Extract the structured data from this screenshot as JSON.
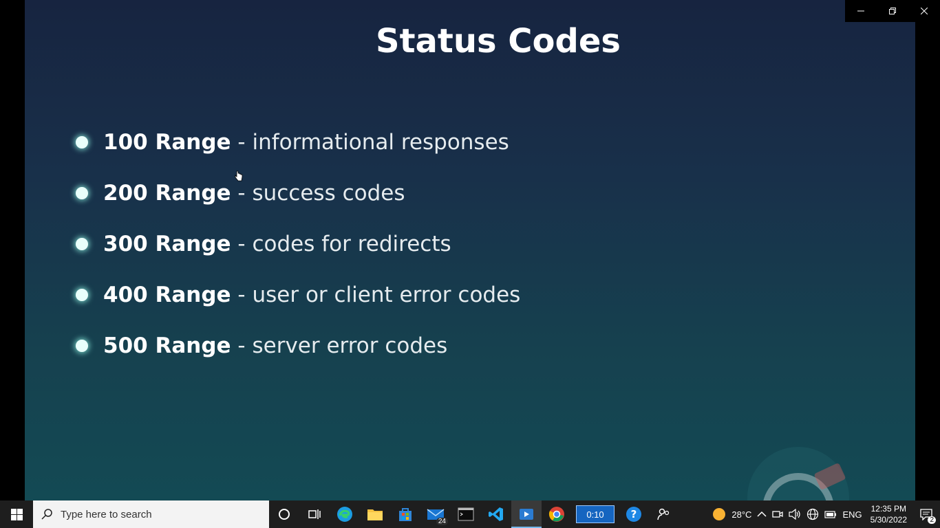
{
  "slide": {
    "title": "Status Codes",
    "bullets": [
      {
        "range": "100 Range",
        "desc": " - informational responses"
      },
      {
        "range": "200 Range",
        "desc": " - success codes"
      },
      {
        "range": "300 Range",
        "desc": " - codes for redirects"
      },
      {
        "range": "400 Range",
        "desc": " - user or client error codes"
      },
      {
        "range": "500 Range",
        "desc": " - server error codes"
      }
    ]
  },
  "taskbar": {
    "search_placeholder": "Type here to search",
    "mail_badge": "24",
    "timer": "0:10",
    "weather_temp": "28°C",
    "language": "ENG",
    "time": "12:35 PM",
    "date": "5/30/2022",
    "notification_count": "2"
  },
  "colors": {
    "accent": "#76b9ed",
    "bullet_glow": "#9ffff0"
  }
}
